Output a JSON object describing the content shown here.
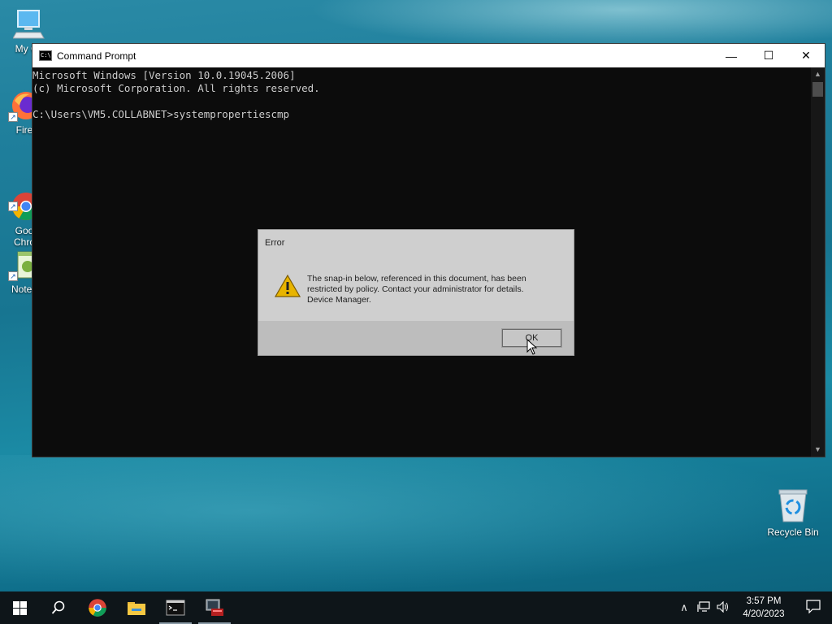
{
  "desktop": {
    "icons": [
      {
        "label": "My Co",
        "icon": "computer-icon"
      },
      {
        "label": "Fire",
        "icon": "firefox-icon"
      },
      {
        "label": "Goo\nChro",
        "icon": "chrome-icon"
      },
      {
        "label": "Notep",
        "icon": "notepad-icon"
      }
    ],
    "recycle_bin_label": "Recycle Bin"
  },
  "cmd_window": {
    "title": "Command Prompt",
    "lines": [
      "Microsoft Windows [Version 10.0.19045.2006]",
      "(c) Microsoft Corporation. All rights reserved.",
      "",
      "C:\\Users\\VM5.COLLABNET>systempropertiescmp"
    ],
    "minimize": "—",
    "maximize": "☐",
    "close": "✕"
  },
  "dialog": {
    "title": "Error",
    "message_line1": "The snap-in below, referenced in this document, has been",
    "message_line2": "restricted by policy. Contact your administrator for details.",
    "message_line3": "Device Manager.",
    "ok_label": "OK"
  },
  "taskbar": {
    "time": "3:57 PM",
    "date": "4/20/2023"
  },
  "colors": {
    "cmd_bg": "#0c0c0c",
    "cmd_text": "#cccccc",
    "taskbar_bg": "#0e1519",
    "dialog_bg": "#cfcfcf"
  }
}
